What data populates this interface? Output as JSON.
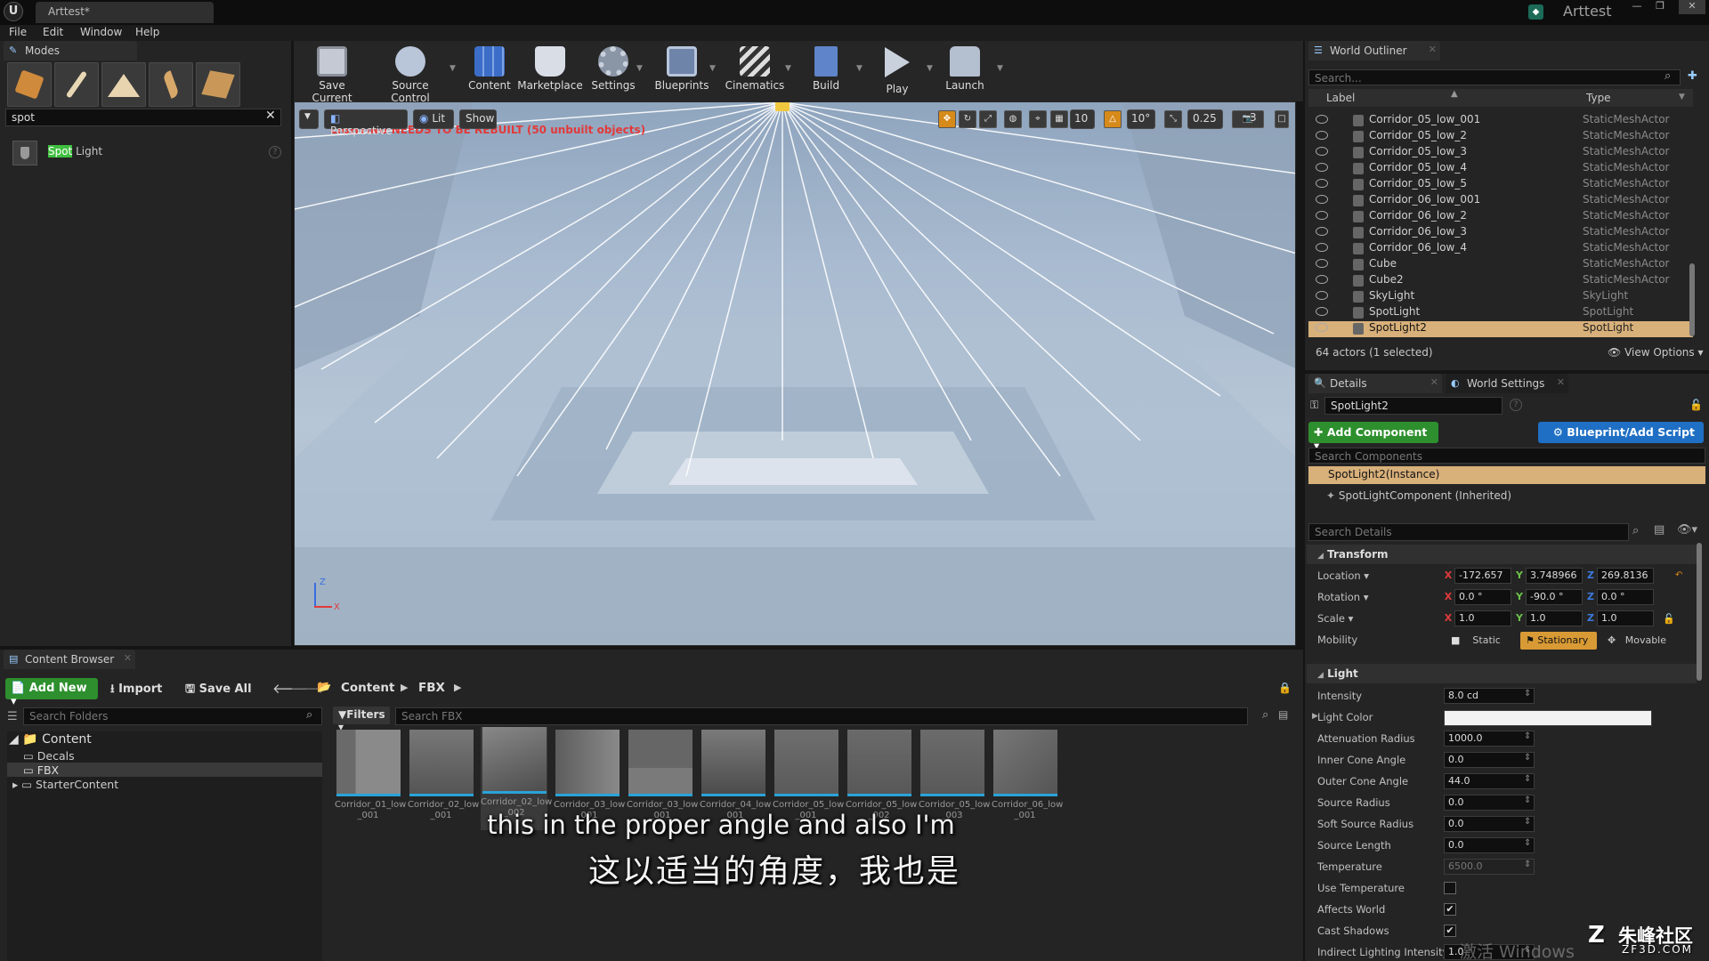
{
  "window": {
    "tab_title": "Arttest*",
    "project_name": "Arttest"
  },
  "menu": [
    "File",
    "Edit",
    "Window",
    "Help"
  ],
  "modes": {
    "title": "Modes",
    "search_value": "spot",
    "result_highlight": "Spot",
    "result_rest": " Light"
  },
  "toolbar": {
    "save_current": "Save Current",
    "source_control": "Source Control",
    "content": "Content",
    "marketplace": "Marketplace",
    "settings": "Settings",
    "blueprints": "Blueprints",
    "cinematics": "Cinematics",
    "build": "Build",
    "play": "Play",
    "launch": "Launch"
  },
  "viewport": {
    "perspective": "Perspective",
    "lit": "Lit",
    "show": "Show",
    "warning": "LIGHTING NEEDS TO BE REBUILT (50 unbuilt objects)",
    "grid_snap": "10",
    "rot_snap": "10°",
    "scale_snap": "0.25",
    "cam_speed": "3",
    "axis_z": "Z",
    "axis_x": "X"
  },
  "outliner": {
    "title": "World Outliner",
    "search_placeholder": "Search...",
    "col_label": "Label",
    "col_type": "Type",
    "rows": [
      {
        "label": "Corridor_05_low_001",
        "type": "StaticMeshActor"
      },
      {
        "label": "Corridor_05_low_2",
        "type": "StaticMeshActor"
      },
      {
        "label": "Corridor_05_low_3",
        "type": "StaticMeshActor"
      },
      {
        "label": "Corridor_05_low_4",
        "type": "StaticMeshActor"
      },
      {
        "label": "Corridor_05_low_5",
        "type": "StaticMeshActor"
      },
      {
        "label": "Corridor_06_low_001",
        "type": "StaticMeshActor"
      },
      {
        "label": "Corridor_06_low_2",
        "type": "StaticMeshActor"
      },
      {
        "label": "Corridor_06_low_3",
        "type": "StaticMeshActor"
      },
      {
        "label": "Corridor_06_low_4",
        "type": "StaticMeshActor"
      },
      {
        "label": "Cube",
        "type": "StaticMeshActor"
      },
      {
        "label": "Cube2",
        "type": "StaticMeshActor"
      },
      {
        "label": "SkyLight",
        "type": "SkyLight"
      },
      {
        "label": "SpotLight",
        "type": "SpotLight"
      },
      {
        "label": "SpotLight2",
        "type": "SpotLight"
      }
    ],
    "status": "64 actors (1 selected)",
    "view_options": "View Options"
  },
  "details": {
    "tab_details": "Details",
    "tab_world_settings": "World Settings",
    "actor_name": "SpotLight2",
    "add_component": "Add Component",
    "blueprint_script": "Blueprint/Add Script",
    "search_components_placeholder": "Search Components",
    "component_instance": "SpotLight2(Instance)",
    "component_child": "SpotLightComponent (Inherited)",
    "search_details_placeholder": "Search Details",
    "transform_header": "Transform",
    "location_label": "Location",
    "rotation_label": "Rotation",
    "scale_label": "Scale",
    "mobility_label": "Mobility",
    "loc": {
      "x": "-172.657",
      "y": "3.748966",
      "z": "269.8136"
    },
    "rot": {
      "x": "0.0 °",
      "y": "-90.0 °",
      "z": "0.0 °"
    },
    "scale": {
      "x": "1.0",
      "y": "1.0",
      "z": "1.0"
    },
    "mobility": {
      "static": "Static",
      "stationary": "Stationary",
      "movable": "Movable"
    },
    "light_header": "Light",
    "light_props": [
      {
        "label": "Intensity",
        "value": "8.0 cd"
      },
      {
        "label": "Light Color",
        "value": ""
      },
      {
        "label": "Attenuation Radius",
        "value": "1000.0"
      },
      {
        "label": "Inner Cone Angle",
        "value": "0.0"
      },
      {
        "label": "Outer Cone Angle",
        "value": "44.0"
      },
      {
        "label": "Source Radius",
        "value": "0.0"
      },
      {
        "label": "Soft Source Radius",
        "value": "0.0"
      },
      {
        "label": "Source Length",
        "value": "0.0"
      },
      {
        "label": "Temperature",
        "value": "6500.0"
      },
      {
        "label": "Use Temperature",
        "value": ""
      },
      {
        "label": "Affects World",
        "value": ""
      },
      {
        "label": "Cast Shadows",
        "value": ""
      },
      {
        "label": "Indirect Lighting Intensity",
        "value": "1.0"
      }
    ]
  },
  "content_browser": {
    "title": "Content Browser",
    "add_new": "Add New",
    "import": "Import",
    "save_all": "Save All",
    "path_root": "Content",
    "path_child": "FBX",
    "search_folders_placeholder": "Search Folders",
    "filters": "Filters",
    "search_fbx_placeholder": "Search FBX",
    "tree_root": "Content",
    "tree_items": [
      "Decals",
      "FBX",
      "StarterContent"
    ],
    "assets": [
      {
        "line1": "Corridor_01_low",
        "line2": "_001"
      },
      {
        "line1": "Corridor_02_low",
        "line2": "_001"
      },
      {
        "line1": "Corridor_02_low",
        "line2": "_002"
      },
      {
        "line1": "Corridor_03_low",
        "line2": "_001"
      },
      {
        "line1": "Corridor_03_low",
        "line2": "_001"
      },
      {
        "line1": "Corridor_04_low",
        "line2": "_001"
      },
      {
        "line1": "Corridor_05_low",
        "line2": "_001"
      },
      {
        "line1": "Corridor_05_low",
        "line2": "_002"
      },
      {
        "line1": "Corridor_05_low",
        "line2": "_003"
      },
      {
        "line1": "Corridor_06_low",
        "line2": "_001"
      }
    ]
  },
  "subtitles": {
    "en": "this in the proper angle and also I'm",
    "zh": "这以适当的角度，我也是"
  },
  "watermark": {
    "brand": "朱峰社区",
    "site": "ZF3D.COM",
    "faded": "激活 Windows"
  }
}
